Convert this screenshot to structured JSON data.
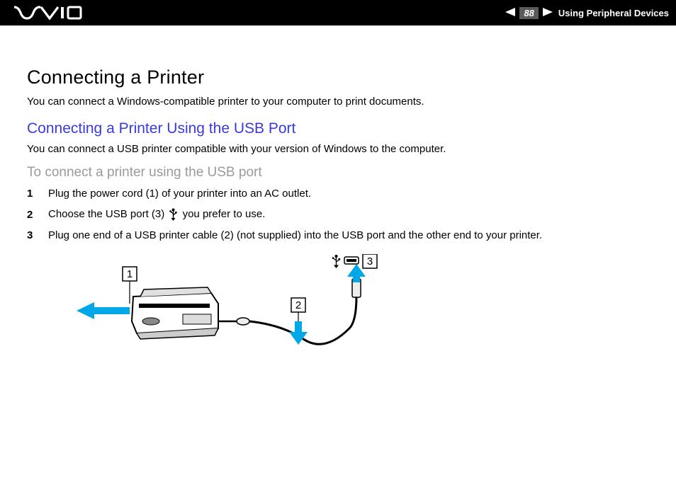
{
  "header": {
    "page_number": "88",
    "section_title": "Using Peripheral Devices"
  },
  "content": {
    "title": "Connecting a Printer",
    "intro": "You can connect a Windows-compatible printer to your computer to print documents.",
    "subtitle": "Connecting a Printer Using the USB Port",
    "subintro": "You can connect a USB printer compatible with your version of Windows to the computer.",
    "procedure_title": "To connect a printer using the USB port",
    "steps": [
      {
        "num": "1",
        "text": "Plug the power cord (1) of your printer into an AC outlet."
      },
      {
        "num": "2",
        "text_before": "Choose the USB port (3) ",
        "text_after": " you prefer to use."
      },
      {
        "num": "3",
        "text": "Plug one end of a USB printer cable (2) (not supplied) into the USB port and the other end to your printer."
      }
    ]
  },
  "diagram": {
    "callouts": [
      "1",
      "2",
      "3"
    ]
  }
}
